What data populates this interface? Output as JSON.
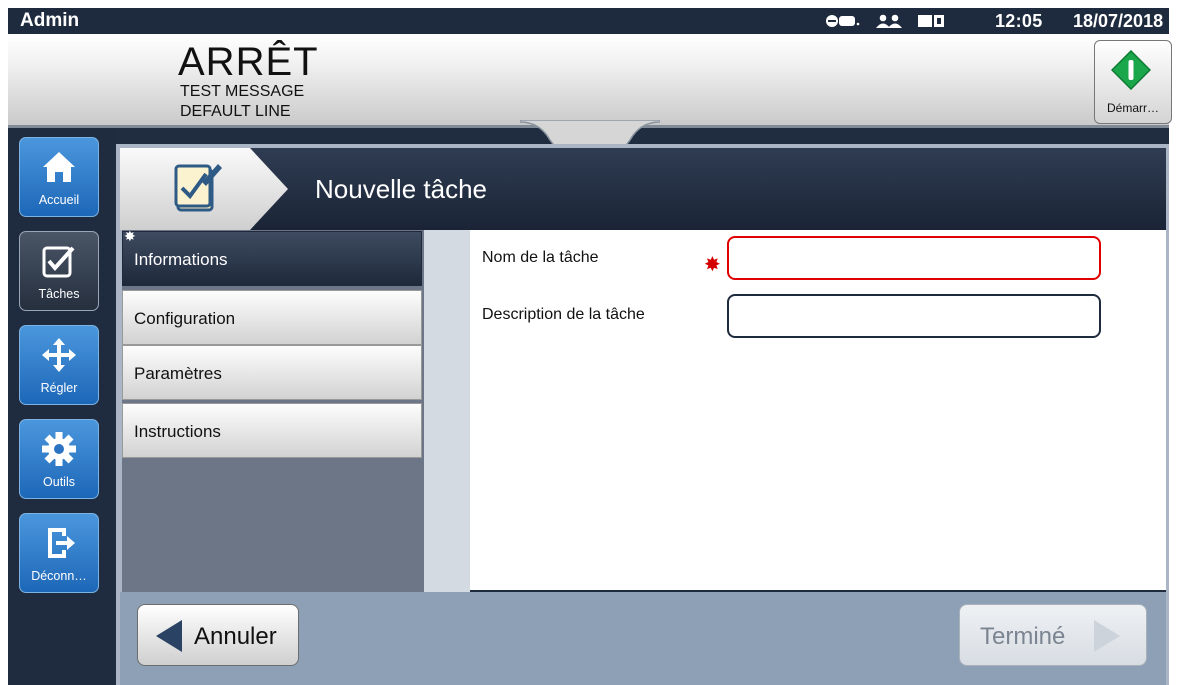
{
  "statusbar": {
    "user": "Admin",
    "time": "12:05",
    "date": "18/07/2018",
    "icons": [
      "printhead-icon",
      "users-icon",
      "storage-icon"
    ]
  },
  "header": {
    "state": "ARRÊT",
    "message_line1": "TEST MESSAGE",
    "message_line2": "DEFAULT LINE",
    "start_label": "Démarr…"
  },
  "nav": {
    "items": [
      {
        "label": "Accueil",
        "icon": "home-icon"
      },
      {
        "label": "Tâches",
        "icon": "tasks-icon",
        "selected": true
      },
      {
        "label": "Régler",
        "icon": "move-icon"
      },
      {
        "label": "Outils",
        "icon": "gear-icon"
      },
      {
        "label": "Déconn…",
        "icon": "logout-icon"
      }
    ]
  },
  "page": {
    "title": "Nouvelle tâche",
    "tabs": [
      {
        "label": "Informations",
        "selected": true
      },
      {
        "label": "Configuration"
      },
      {
        "label": "Paramètres"
      },
      {
        "label": "Instructions"
      }
    ]
  },
  "form": {
    "name_label": "Nom de la tâche",
    "name_value": "",
    "name_required_marker": "✸",
    "description_label": "Description de la tâche",
    "description_value": ""
  },
  "footer": {
    "cancel_label": "Annuler",
    "done_label": "Terminé"
  },
  "colors": {
    "accent_blue": "#2f7fd0",
    "dark_navy": "#1e2a3e",
    "required_red": "#e00000",
    "start_green": "#1aa64a"
  }
}
